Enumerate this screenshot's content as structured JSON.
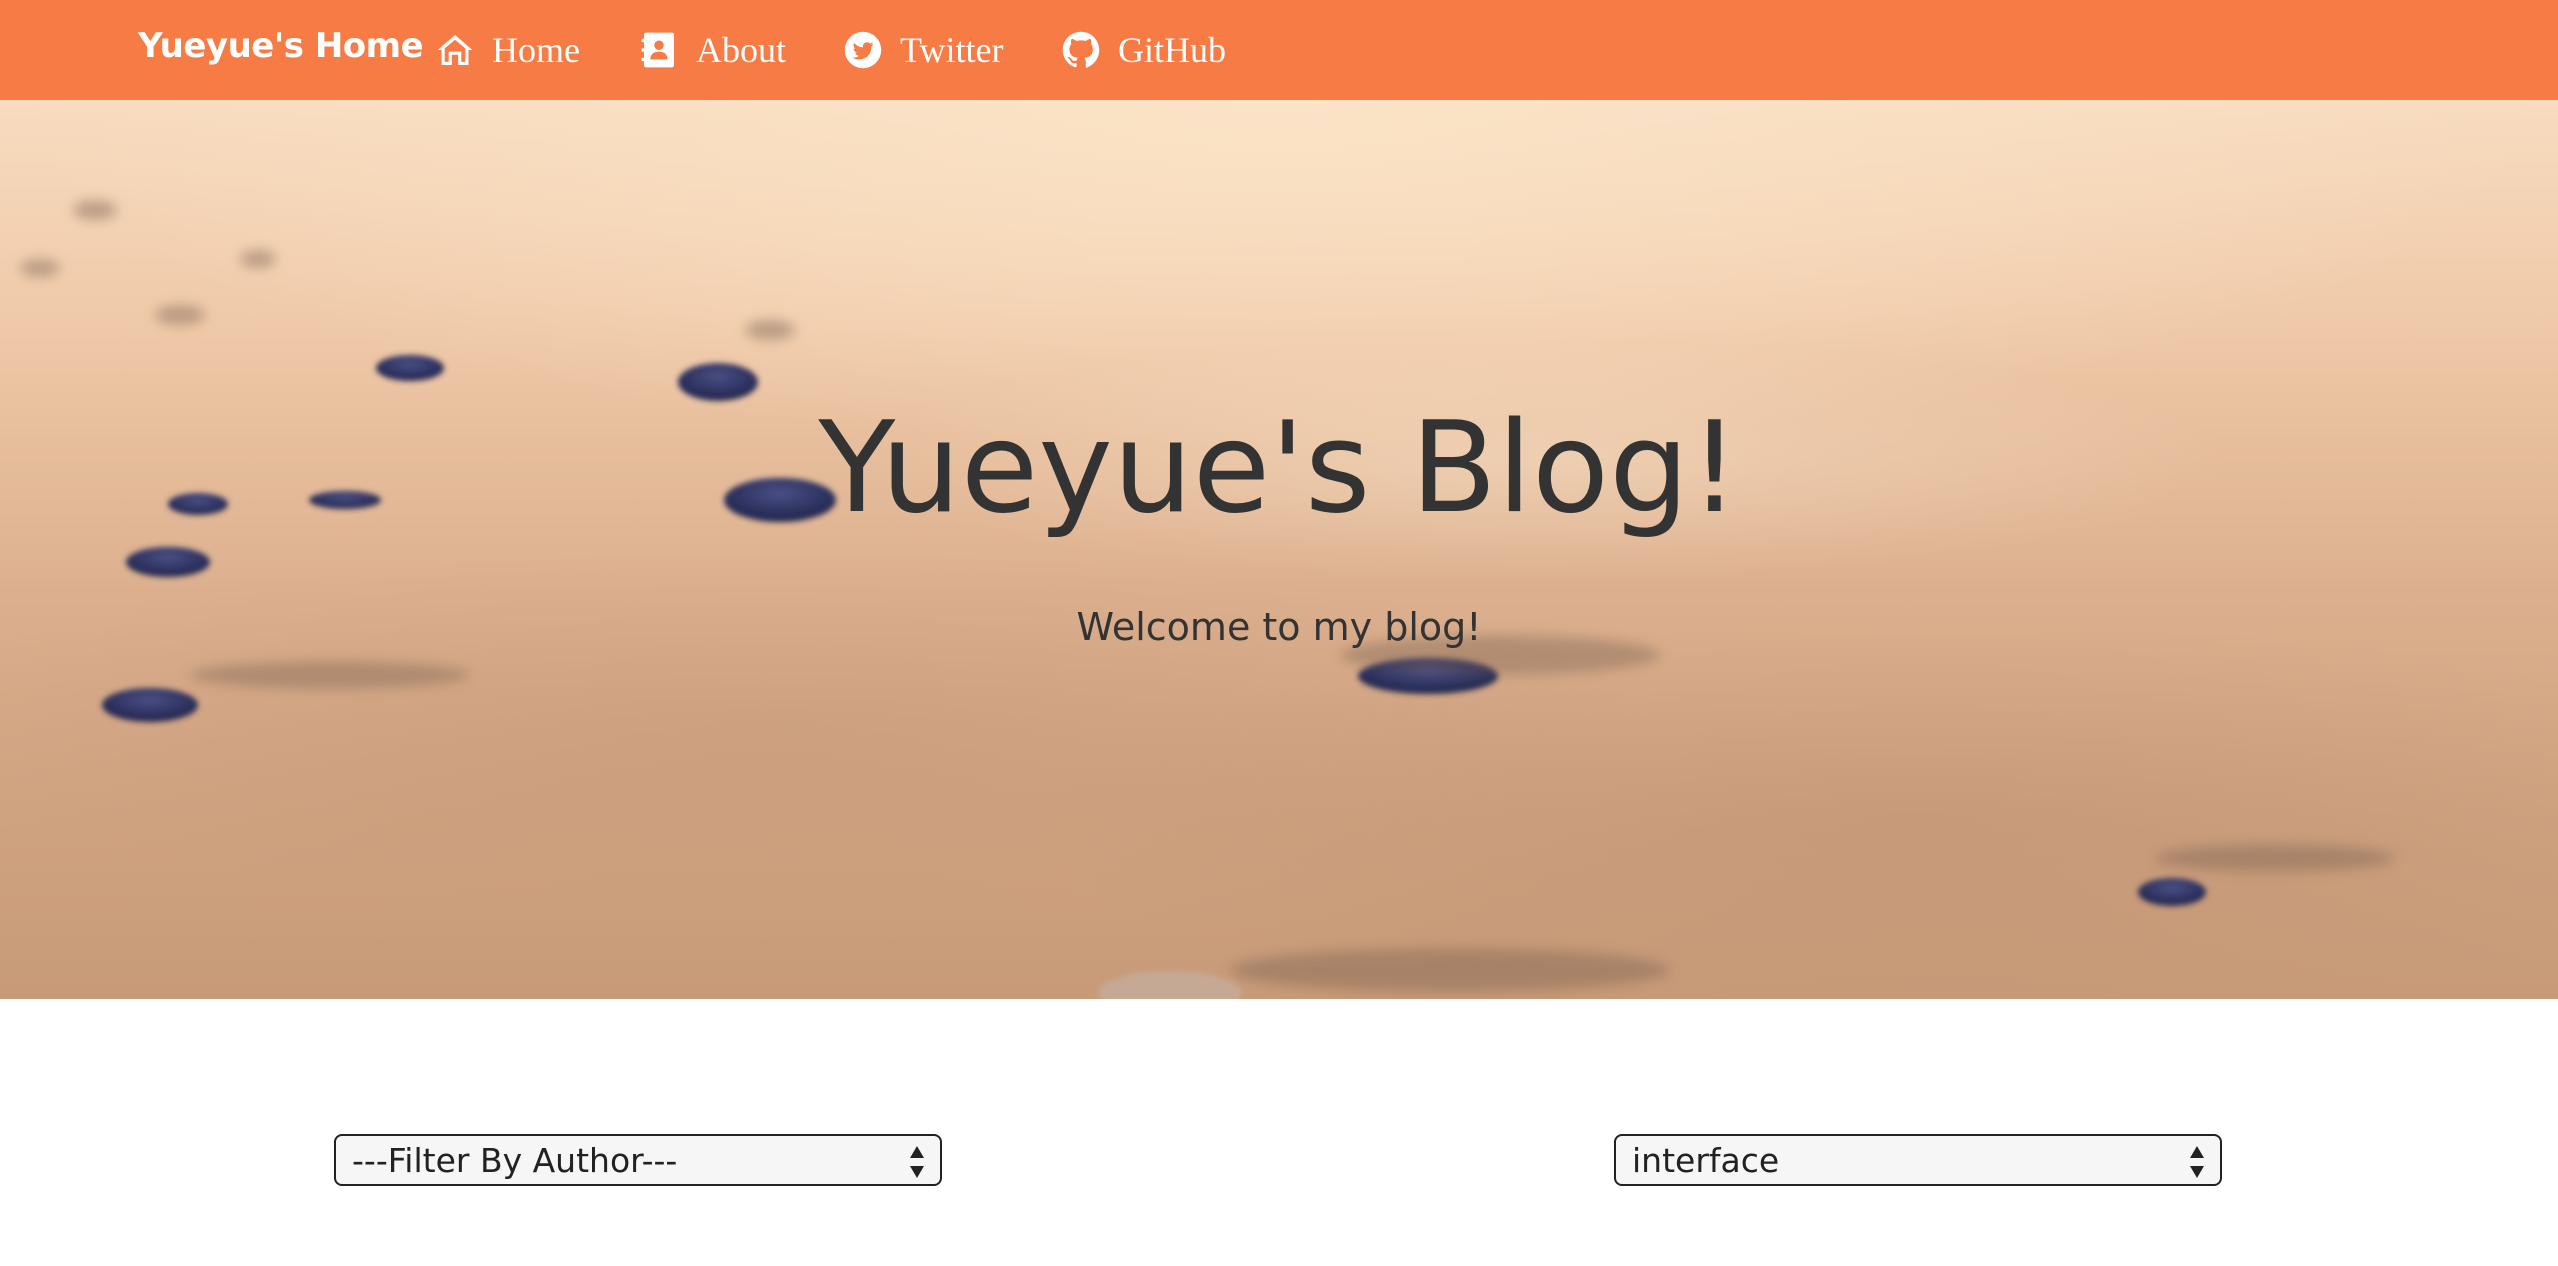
{
  "navbar": {
    "brand": "Yueyue's Home",
    "background_color": "#f77b44",
    "items": [
      {
        "label": "Home",
        "icon": "home-icon"
      },
      {
        "label": "About",
        "icon": "address-book-icon"
      },
      {
        "label": "Twitter",
        "icon": "twitter-icon"
      },
      {
        "label": "GitHub",
        "icon": "github-icon"
      }
    ]
  },
  "hero": {
    "title": "Yueyue's Blog!",
    "subtitle": "Welcome to my blog!",
    "background": "sandy beach with blurred dark pebbles"
  },
  "filters": {
    "author": {
      "selected": "---Filter By Author---"
    },
    "tag": {
      "selected": "interface"
    }
  }
}
